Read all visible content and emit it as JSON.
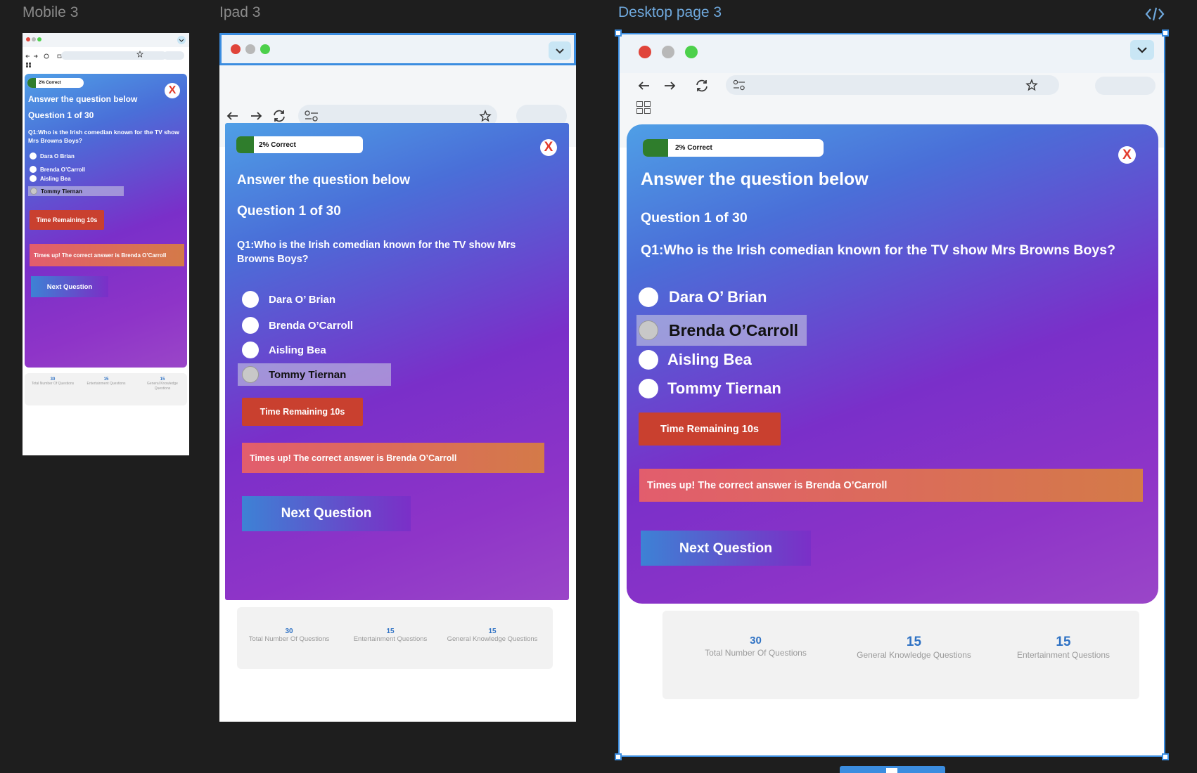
{
  "canvas": {
    "frames": [
      {
        "label": "Mobile 3"
      },
      {
        "label": "Ipad 3"
      },
      {
        "label": "Desktop page 3"
      }
    ],
    "code_icon": "code-icon"
  },
  "quiz": {
    "progress_label": "2% Correct",
    "progress_fraction": 0.02,
    "close_label": "X",
    "heading": "Answer the question below",
    "question_counter": "Question 1 of  30",
    "question": "Q1:Who is  the Irish comedian known for the TV show Mrs Browns Boys?",
    "timer": "Time Remaining  10s",
    "answer_message": "Times up! The correct answer is Brenda O’Carroll",
    "next_label": "Next Question"
  },
  "mobile": {
    "options": [
      "Dara O Brian",
      "Brenda O’Carroll",
      "Aisling Bea",
      "Tommy Tiernan"
    ],
    "selected_index": 3,
    "answer_message": "Times up! The correct answer is Brenda O’Carroll",
    "stats": [
      {
        "value": "30",
        "label": "Total Number Of Questions"
      },
      {
        "value": "15",
        "label": "Entertainment Questions"
      },
      {
        "value": "15",
        "label": "General Knowledge Questions"
      }
    ]
  },
  "ipad": {
    "options": [
      "Dara O’ Brian",
      "Brenda O’Carroll",
      "Aisling Bea",
      "Tommy Tiernan"
    ],
    "selected_index": 3,
    "stats": [
      {
        "value": "30",
        "label": "Total Number Of Questions"
      },
      {
        "value": "15",
        "label": "Entertainment Questions"
      },
      {
        "value": "15",
        "label": "General Knowledge Questions"
      }
    ]
  },
  "desktop": {
    "options": [
      "Dara O’ Brian",
      "Brenda O’Carroll",
      "Aisling Bea",
      "Tommy Tiernan"
    ],
    "selected_index": 1,
    "stats": [
      {
        "value": "30",
        "label": "Total Number Of Questions"
      },
      {
        "value": "15",
        "label": "General Knowledge Questions"
      },
      {
        "value": "15",
        "label": "Entertainment Questions"
      }
    ]
  },
  "colors": {
    "canvas_bg": "#1e1e1e",
    "selection_blue": "#3b8de0",
    "progress_green": "#2f7d2c",
    "timer_red": "#c9402f",
    "stat_blue": "#2f72c4",
    "traffic_red": "#e0443a",
    "traffic_gray": "#b8b8b8",
    "traffic_green": "#4cd04b"
  }
}
